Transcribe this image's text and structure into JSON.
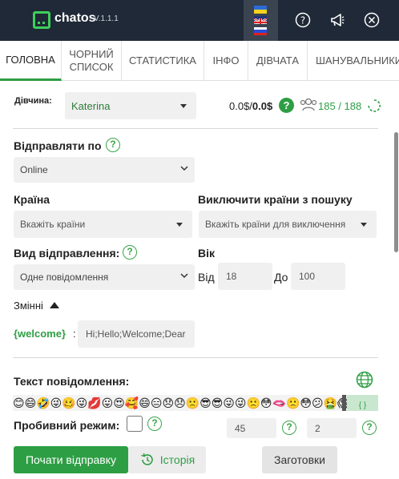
{
  "header": {
    "app_name": "chatos",
    "version": "V.1.1.1",
    "flag_ua": "ukrainian-flag-icon",
    "flag_uk": "british-flag-icon",
    "flag_ru": "russian-flag-icon",
    "help_icon": "help-circle-icon",
    "announce_icon": "megaphone-icon",
    "close_icon": "close-circle-icon",
    "bg_color": "#1f2937",
    "accent": "#3ecf5a"
  },
  "tabs": [
    {
      "label": "ГОЛОВНА",
      "active": true
    },
    {
      "label": "ЧОРНИЙ СПИСОК",
      "active": false
    },
    {
      "label": "СТАТИСТИКА",
      "active": false
    },
    {
      "label": "ІНФО",
      "active": false
    },
    {
      "label": "ДІВЧАТА",
      "active": false
    },
    {
      "label": "ШАНУВАЛЬНИКИ",
      "active": false
    }
  ],
  "girl": {
    "label": "Дівчина:",
    "selected": "Katerina",
    "balance_light": "0.0$/",
    "balance_bold": "0.0$",
    "count": "185 / 188"
  },
  "send_by": {
    "label": "Відправляти по",
    "value": "Online"
  },
  "country": {
    "label": "Країна",
    "placeholder": "Вкажіть країни"
  },
  "exclude": {
    "label": "Виключити країни з пошуку",
    "placeholder": "Вкажіть країни для виключення"
  },
  "send_type": {
    "label": "Вид відправлення:",
    "value": "Одне повідомлення"
  },
  "age": {
    "label": "Вік",
    "from_label": "Від",
    "from_value": "18",
    "to_label": "До",
    "to_value": "100"
  },
  "variables": {
    "label": "Змінні",
    "key": "{welcome}",
    "colon": ":",
    "value": "Hi;Hello;Welcome;Dear"
  },
  "message": {
    "label": "Текст повідомлення:",
    "emojis": "😊😄🤣😜🥴😜💋😛😍🥰😄😑😞😞🙁😎😎😜😜🙁😳🫦🙁😳😕🤮😱",
    "braces": "{ }"
  },
  "breakthrough": {
    "label": "Пробивний режим:",
    "value1": "45",
    "value2": "2"
  },
  "buttons": {
    "start": "Почати відправку",
    "history": "Історія",
    "templates": "Заготовки"
  },
  "colors": {
    "green": "#2e9e44"
  }
}
